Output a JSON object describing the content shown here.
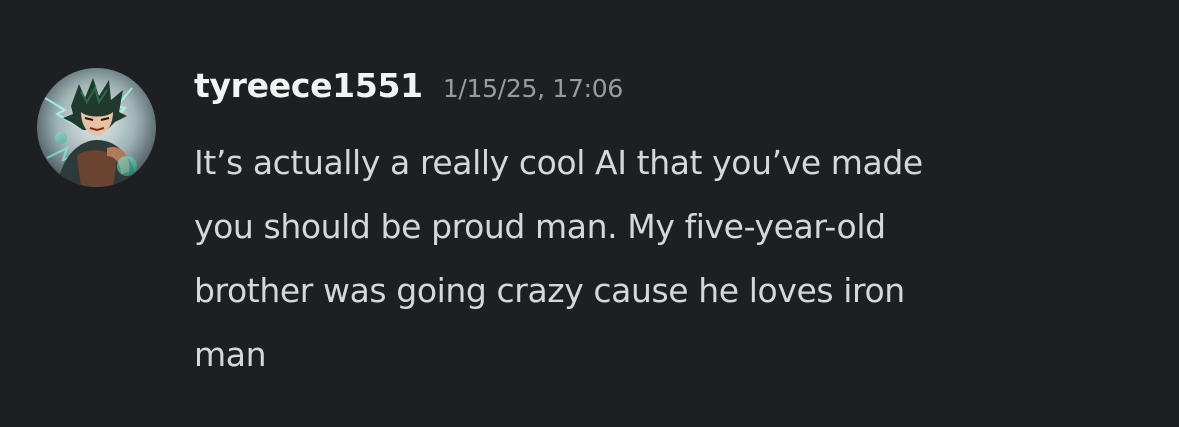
{
  "message": {
    "author": "tyreece1551",
    "timestamp": "1/15/25, 17:06",
    "avatar_icon": "user-avatar-anime-character",
    "lines": [
      "It’s actually a really cool AI that you’ve made",
      "you should be proud man. My five-year-old",
      "brother was going crazy cause he loves iron",
      "man"
    ]
  },
  "colors": {
    "background": "#1e1f23",
    "username": "#f2f3f5",
    "timestamp": "#9a9ba2",
    "text": "#d6d7dc"
  }
}
